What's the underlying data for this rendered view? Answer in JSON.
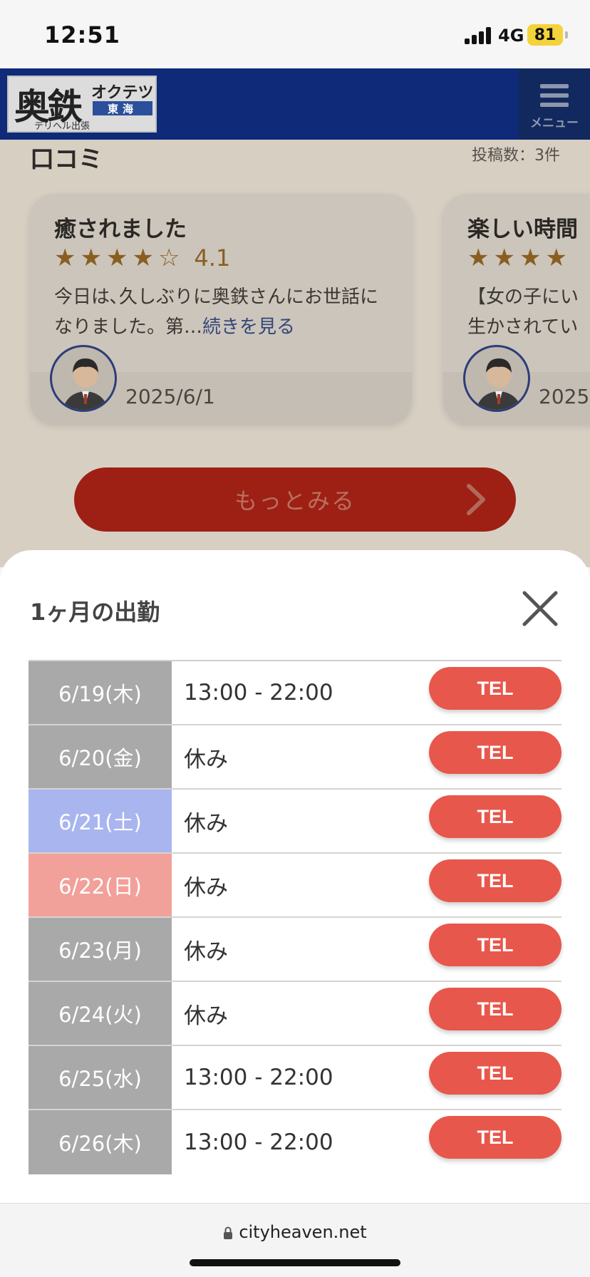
{
  "status_bar": {
    "time": "12:51",
    "network": "4G",
    "battery": "81"
  },
  "header": {
    "logo": {
      "kanji": "奥鉄",
      "kana": "オクテツ",
      "region": "東海",
      "sub": "デリヘル出張"
    },
    "menu_label": "メニュー",
    "header_color": "#0f2a78"
  },
  "reviews_section": {
    "title": "口コミ",
    "count_text": "投稿数：3件",
    "cards": [
      {
        "title": "癒されました",
        "rating": "4.1",
        "stars_filled": 4,
        "text": "今日は､久しぶりに奥鉄さんにお世話になりました。第…",
        "more_link": "続きを見る",
        "date": "2025/6/1"
      },
      {
        "title": "楽しい時間",
        "rating": "",
        "stars_filled": 4,
        "text": "【女の子にい\n生かされてい",
        "more_link": "",
        "date": "2025"
      }
    ],
    "more_button": "もっとみる"
  },
  "modal": {
    "title": "1ヶ月の出勤",
    "rows": [
      {
        "date": "6/19(木)",
        "hours": "13:00 - 22:00",
        "tel": "TEL",
        "day_type": "weekday"
      },
      {
        "date": "6/20(金)",
        "hours": "休み",
        "tel": "TEL",
        "day_type": "weekday"
      },
      {
        "date": "6/21(土)",
        "hours": "休み",
        "tel": "TEL",
        "day_type": "sat"
      },
      {
        "date": "6/22(日)",
        "hours": "休み",
        "tel": "TEL",
        "day_type": "sun"
      },
      {
        "date": "6/23(月)",
        "hours": "休み",
        "tel": "TEL",
        "day_type": "weekday"
      },
      {
        "date": "6/24(火)",
        "hours": "休み",
        "tel": "TEL",
        "day_type": "weekday"
      },
      {
        "date": "6/25(水)",
        "hours": "13:00 - 22:00",
        "tel": "TEL",
        "day_type": "weekday"
      },
      {
        "date": "6/26(木)",
        "hours": "13:00 - 22:00",
        "tel": "TEL",
        "day_type": "weekday"
      }
    ],
    "colors": {
      "weekday": "#a9a9a9",
      "saturday": "#a9b5ef",
      "sunday": "#f2a09a",
      "tel_button": "#e8574b"
    }
  },
  "browser": {
    "url": "cityheaven.net"
  }
}
